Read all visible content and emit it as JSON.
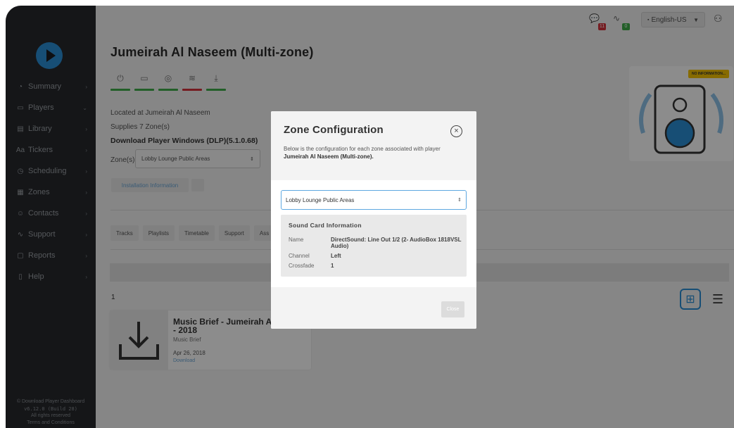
{
  "sidebar": {
    "items": [
      {
        "label": "Summary",
        "icon": "dashboard-icon"
      },
      {
        "label": "Players",
        "icon": "player-icon"
      },
      {
        "label": "Library",
        "icon": "library-icon"
      },
      {
        "label": "Tickers",
        "icon": "ticker-icon"
      },
      {
        "label": "Scheduling",
        "icon": "clock-icon"
      },
      {
        "label": "Zones",
        "icon": "grid-icon"
      },
      {
        "label": "Contacts",
        "icon": "contacts-icon"
      },
      {
        "label": "Support",
        "icon": "pulse-icon"
      },
      {
        "label": "Reports",
        "icon": "report-icon"
      },
      {
        "label": "Help",
        "icon": "help-icon"
      }
    ],
    "footer": {
      "line1": "© Download Player Dashboard",
      "line2": "v6.12.0 (Build 28)",
      "line3": "All rights reserved",
      "line4": "Terms and Conditions"
    }
  },
  "topbar": {
    "messages_badge": "11",
    "activity_badge": "0",
    "language": "English-US"
  },
  "player": {
    "title": "Jumeirah Al Naseem (Multi-zone)",
    "location": "Located at Jumeirah Al Naseem",
    "supplies": "Supplies 7 Zone(s)",
    "version": "Download Player Windows (DLP)(5.1.0.68)",
    "zone_label": "Zone(s)",
    "zone_selected": "Lobby Lounge Public Areas",
    "install_button": "Installation Information",
    "no_info_badge": "NO INFORMATION...",
    "tabs": [
      "Tracks",
      "Playlists",
      "Timetable",
      "Support",
      "Ass"
    ],
    "count": "1"
  },
  "card": {
    "title": "Music Brief - Jumeirah A... - 2018",
    "title_line1": "Music Brief - Jumeirah A",
    "title_line2": "- 2018",
    "type": "Music Brief",
    "date": "Apr 26, 2018",
    "link": "Download"
  },
  "modal": {
    "title": "Zone Configuration",
    "desc_prefix": "Below is the configuration for each zone associated with player",
    "desc_player": "Jumeirah Al Naseem (Multi-zone).",
    "select_value": "Lobby Lounge Public Areas",
    "section_title": "Sound Card Information",
    "fields": [
      {
        "key": "Name",
        "value": "DirectSound: Line Out 1/2 (2- AudioBox 1818VSL Audio)"
      },
      {
        "key": "Channel",
        "value": "Left"
      },
      {
        "key": "Crossfade",
        "value": "1"
      }
    ],
    "close_button": "Close"
  },
  "colors": {
    "accent": "#2a8fd6",
    "status_green": "#3fae4a",
    "status_red": "#d6323b",
    "sidebar_bg": "#27292d",
    "badge_red": "#d6323b",
    "badge_green": "#3fae4a",
    "no_info_yellow": "#f6c400"
  }
}
